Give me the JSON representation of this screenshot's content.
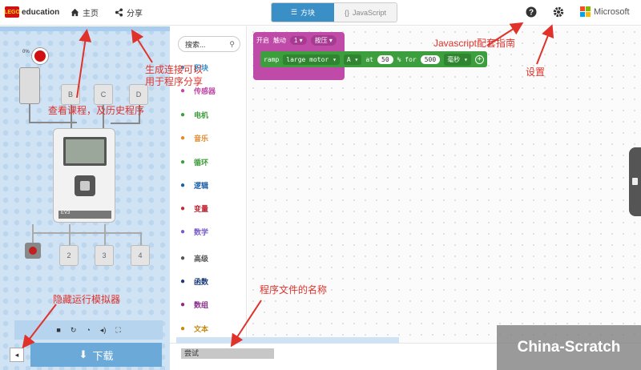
{
  "header": {
    "logo_text": "education",
    "logo_badge": "LEGO",
    "home_label": "主页",
    "share_label": "分享",
    "tab_blocks": "方块",
    "tab_javascript": "JavaScript",
    "brand": "Microsoft",
    "brand_colors": [
      "#f25022",
      "#7fba00",
      "#00a4ef",
      "#ffb900"
    ]
  },
  "simulator": {
    "ports_top": [
      "B",
      "C",
      "D"
    ],
    "ports_bottom": [
      "2",
      "3",
      "4"
    ],
    "sensor_pct": "0%",
    "brick_label": "EV3",
    "toolbar_icons": [
      "stop-icon",
      "restart-icon",
      "slowmo-icon",
      "mute-icon",
      "fullscreen-icon"
    ],
    "download_label": "下载"
  },
  "toolbox": {
    "search_placeholder": "搜索...",
    "categories": [
      {
        "label": "积块",
        "icon": "brick-icon",
        "color": "#3a8fc7"
      },
      {
        "label": "传感器",
        "icon": "sensor-icon",
        "color": "#c04aa8"
      },
      {
        "label": "电机",
        "icon": "motor-icon",
        "color": "#3d9e3d"
      },
      {
        "label": "音乐",
        "icon": "music-icon",
        "color": "#e28a2b"
      },
      {
        "label": "循环",
        "icon": "loop-icon",
        "color": "#3d9e3d"
      },
      {
        "label": "逻辑",
        "icon": "logic-icon",
        "color": "#1b5fa8"
      },
      {
        "label": "变量",
        "icon": "variable-icon",
        "color": "#c02d3a"
      },
      {
        "label": "数学",
        "icon": "math-icon",
        "color": "#7a5cc8"
      },
      {
        "label": "高级",
        "icon": "advanced-icon",
        "color": "#555555"
      },
      {
        "label": "函数",
        "icon": "function-icon",
        "color": "#1b3a7a"
      },
      {
        "label": "数组",
        "icon": "array-icon",
        "color": "#8a2b8a"
      },
      {
        "label": "文本",
        "icon": "text-icon",
        "color": "#c58a12"
      }
    ]
  },
  "workspace": {
    "hat_block": {
      "start": "开启",
      "event": "触动",
      "port": "1",
      "action": "按压"
    },
    "motor_block": {
      "cmd": "ramp",
      "motor": "large motor",
      "port": "A",
      "at": "at",
      "speed": "50",
      "pct": "% for",
      "duration": "500",
      "unit": "毫秒"
    }
  },
  "footer": {
    "filename": "尝试",
    "watermark": "China-Scratch"
  },
  "annotations": {
    "js_guide": "Javascript配套指南",
    "settings": "设置",
    "share_note_1": "生成连接可以",
    "share_note_2": "用于程序分享",
    "courses": "查看课程，及历史程序",
    "filename_note": "程序文件的名称",
    "hide_sim": "隐藏运行模拟器"
  }
}
